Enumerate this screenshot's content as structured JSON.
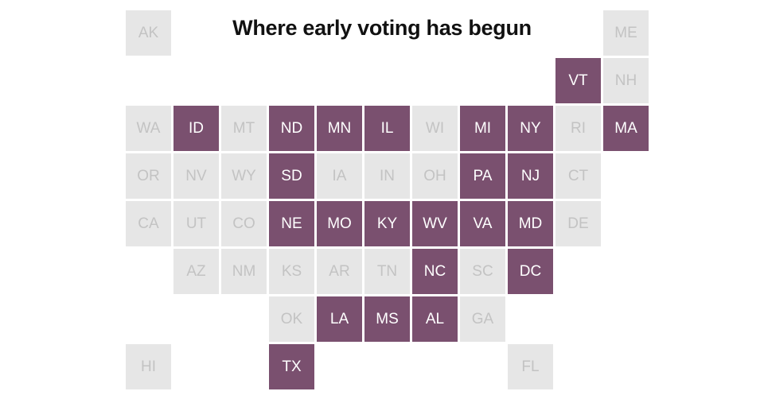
{
  "chart_data": {
    "type": "tile-grid-map",
    "title": "Where early voting has begun",
    "colors": {
      "begun": "#7a506f",
      "not_begun": "#e6e6e6",
      "begun_text": "#ffffff",
      "not_begun_text": "#c3c3c3"
    },
    "rows": [
      [
        {
          "c": 0,
          "s": "AK",
          "v": false
        },
        {
          "c": 10,
          "s": "ME",
          "v": false
        }
      ],
      [
        {
          "c": 9,
          "s": "VT",
          "v": true
        },
        {
          "c": 10,
          "s": "NH",
          "v": false
        }
      ],
      [
        {
          "c": 0,
          "s": "WA",
          "v": false
        },
        {
          "c": 1,
          "s": "ID",
          "v": true
        },
        {
          "c": 2,
          "s": "MT",
          "v": false
        },
        {
          "c": 3,
          "s": "ND",
          "v": true
        },
        {
          "c": 4,
          "s": "MN",
          "v": true
        },
        {
          "c": 5,
          "s": "IL",
          "v": true
        },
        {
          "c": 6,
          "s": "WI",
          "v": false
        },
        {
          "c": 7,
          "s": "MI",
          "v": true
        },
        {
          "c": 8,
          "s": "NY",
          "v": true
        },
        {
          "c": 9,
          "s": "RI",
          "v": false
        },
        {
          "c": 10,
          "s": "MA",
          "v": true
        }
      ],
      [
        {
          "c": 0,
          "s": "OR",
          "v": false
        },
        {
          "c": 1,
          "s": "NV",
          "v": false
        },
        {
          "c": 2,
          "s": "WY",
          "v": false
        },
        {
          "c": 3,
          "s": "SD",
          "v": true
        },
        {
          "c": 4,
          "s": "IA",
          "v": false
        },
        {
          "c": 5,
          "s": "IN",
          "v": false
        },
        {
          "c": 6,
          "s": "OH",
          "v": false
        },
        {
          "c": 7,
          "s": "PA",
          "v": true
        },
        {
          "c": 8,
          "s": "NJ",
          "v": true
        },
        {
          "c": 9,
          "s": "CT",
          "v": false
        }
      ],
      [
        {
          "c": 0,
          "s": "CA",
          "v": false
        },
        {
          "c": 1,
          "s": "UT",
          "v": false
        },
        {
          "c": 2,
          "s": "CO",
          "v": false
        },
        {
          "c": 3,
          "s": "NE",
          "v": true
        },
        {
          "c": 4,
          "s": "MO",
          "v": true
        },
        {
          "c": 5,
          "s": "KY",
          "v": true
        },
        {
          "c": 6,
          "s": "WV",
          "v": true
        },
        {
          "c": 7,
          "s": "VA",
          "v": true
        },
        {
          "c": 8,
          "s": "MD",
          "v": true
        },
        {
          "c": 9,
          "s": "DE",
          "v": false
        }
      ],
      [
        {
          "c": 1,
          "s": "AZ",
          "v": false
        },
        {
          "c": 2,
          "s": "NM",
          "v": false
        },
        {
          "c": 3,
          "s": "KS",
          "v": false
        },
        {
          "c": 4,
          "s": "AR",
          "v": false
        },
        {
          "c": 5,
          "s": "TN",
          "v": false
        },
        {
          "c": 6,
          "s": "NC",
          "v": true
        },
        {
          "c": 7,
          "s": "SC",
          "v": false
        },
        {
          "c": 8,
          "s": "DC",
          "v": true
        }
      ],
      [
        {
          "c": 3,
          "s": "OK",
          "v": false
        },
        {
          "c": 4,
          "s": "LA",
          "v": true
        },
        {
          "c": 5,
          "s": "MS",
          "v": true
        },
        {
          "c": 6,
          "s": "AL",
          "v": true
        },
        {
          "c": 7,
          "s": "GA",
          "v": false
        }
      ],
      [
        {
          "c": 0,
          "s": "HI",
          "v": false
        },
        {
          "c": 3,
          "s": "TX",
          "v": true
        },
        {
          "c": 8,
          "s": "FL",
          "v": false
        }
      ]
    ]
  }
}
